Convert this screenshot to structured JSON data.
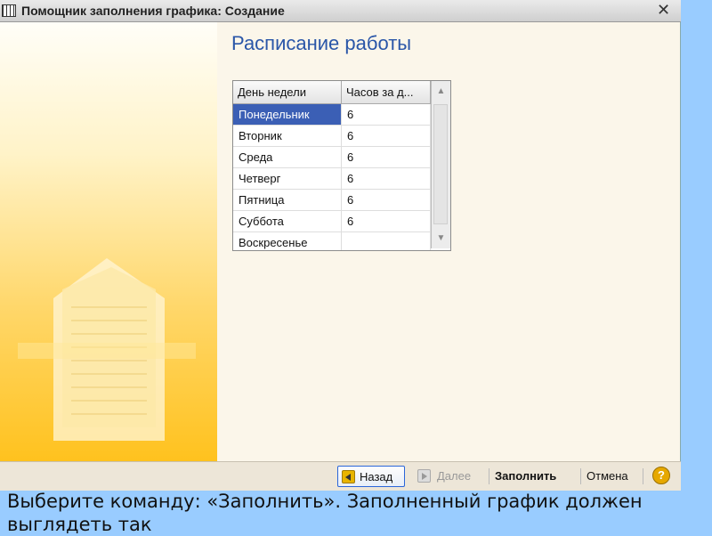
{
  "window": {
    "title": "Помощник заполнения графика: Создание",
    "close_label": "✕"
  },
  "main": {
    "heading": "Расписание работы"
  },
  "table": {
    "columns": [
      "День недели",
      "Часов за д..."
    ],
    "rows": [
      {
        "day": "Понедельник",
        "hours": "6",
        "selected": true
      },
      {
        "day": "Вторник",
        "hours": "6"
      },
      {
        "day": "Среда",
        "hours": "6"
      },
      {
        "day": "Четверг",
        "hours": "6"
      },
      {
        "day": "Пятница",
        "hours": "6"
      },
      {
        "day": "Суббота",
        "hours": "6"
      },
      {
        "day": "Воскресенье",
        "hours": ""
      }
    ]
  },
  "footer": {
    "back_label": "Назад",
    "next_label": "Далее",
    "fill_label": "Заполнить",
    "cancel_label": "Отмена",
    "help_label": "?"
  },
  "caption": "Выберите команду: «Заполнить». Заполненный график должен выглядеть так",
  "colors": {
    "heading": "#2a56a8",
    "selection": "#3b5fb5",
    "side_gradient_end": "#ffc21e",
    "background": "#99ccff"
  }
}
